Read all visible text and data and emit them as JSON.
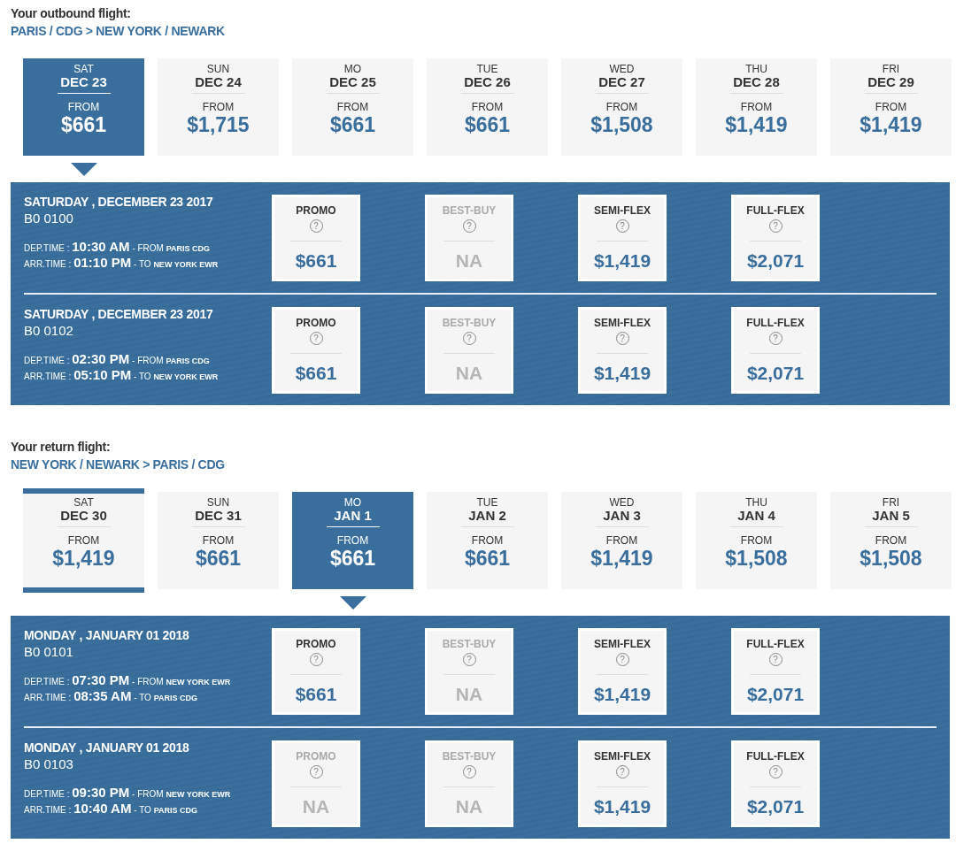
{
  "sections": [
    {
      "title": "Your outbound flight:",
      "route": "PARIS / CDG > NEW YORK / NEWARK",
      "days": [
        {
          "weekday": "SAT",
          "date": "DEC 23",
          "from": "FROM",
          "price": "$661",
          "selected": true,
          "bordered": false
        },
        {
          "weekday": "SUN",
          "date": "DEC 24",
          "from": "FROM",
          "price": "$1,715",
          "selected": false,
          "bordered": false
        },
        {
          "weekday": "MO",
          "date": "DEC 25",
          "from": "FROM",
          "price": "$661",
          "selected": false,
          "bordered": false
        },
        {
          "weekday": "TUE",
          "date": "DEC 26",
          "from": "FROM",
          "price": "$661",
          "selected": false,
          "bordered": false
        },
        {
          "weekday": "WED",
          "date": "DEC 27",
          "from": "FROM",
          "price": "$1,508",
          "selected": false,
          "bordered": false
        },
        {
          "weekday": "THU",
          "date": "DEC 28",
          "from": "FROM",
          "price": "$1,419",
          "selected": false,
          "bordered": false
        },
        {
          "weekday": "FRI",
          "date": "DEC 29",
          "from": "FROM",
          "price": "$1,419",
          "selected": false,
          "bordered": false
        }
      ],
      "flights": [
        {
          "date": "SATURDAY , DECEMBER 23 2017",
          "number": "B0 0100",
          "dep_label": "DEP.TIME :",
          "dep_time": "10:30 AM",
          "dep_prefix": "- FROM",
          "dep_place": "PARIS CDG",
          "arr_label": "ARR.TIME :",
          "arr_time": "01:10 PM",
          "arr_prefix": "- TO",
          "arr_place": "NEW YORK EWR",
          "fares": [
            {
              "name": "PROMO",
              "help": "?",
              "price": "$661",
              "available": true
            },
            {
              "name": "BEST-BUY",
              "help": "?",
              "price": "NA",
              "available": false
            },
            {
              "name": "SEMI-FLEX",
              "help": "?",
              "price": "$1,419",
              "available": true
            },
            {
              "name": "FULL-FLEX",
              "help": "?",
              "price": "$2,071",
              "available": true
            }
          ]
        },
        {
          "date": "SATURDAY , DECEMBER 23 2017",
          "number": "B0 0102",
          "dep_label": "DEP.TIME :",
          "dep_time": "02:30 PM",
          "dep_prefix": "- FROM",
          "dep_place": "PARIS CDG",
          "arr_label": "ARR.TIME :",
          "arr_time": "05:10 PM",
          "arr_prefix": "- TO",
          "arr_place": "NEW YORK EWR",
          "fares": [
            {
              "name": "PROMO",
              "help": "?",
              "price": "$661",
              "available": true
            },
            {
              "name": "BEST-BUY",
              "help": "?",
              "price": "NA",
              "available": false
            },
            {
              "name": "SEMI-FLEX",
              "help": "?",
              "price": "$1,419",
              "available": true
            },
            {
              "name": "FULL-FLEX",
              "help": "?",
              "price": "$2,071",
              "available": true
            }
          ]
        }
      ]
    },
    {
      "title": "Your return flight:",
      "route": "NEW YORK / NEWARK > PARIS / CDG",
      "days": [
        {
          "weekday": "SAT",
          "date": "DEC 30",
          "from": "FROM",
          "price": "$1,419",
          "selected": false,
          "bordered": true
        },
        {
          "weekday": "SUN",
          "date": "DEC 31",
          "from": "FROM",
          "price": "$661",
          "selected": false,
          "bordered": false
        },
        {
          "weekday": "MO",
          "date": "JAN 1",
          "from": "FROM",
          "price": "$661",
          "selected": true,
          "bordered": false
        },
        {
          "weekday": "TUE",
          "date": "JAN 2",
          "from": "FROM",
          "price": "$661",
          "selected": false,
          "bordered": false
        },
        {
          "weekday": "WED",
          "date": "JAN 3",
          "from": "FROM",
          "price": "$1,419",
          "selected": false,
          "bordered": false
        },
        {
          "weekday": "THU",
          "date": "JAN 4",
          "from": "FROM",
          "price": "$1,508",
          "selected": false,
          "bordered": false
        },
        {
          "weekday": "FRI",
          "date": "JAN 5",
          "from": "FROM",
          "price": "$1,508",
          "selected": false,
          "bordered": false
        }
      ],
      "flights": [
        {
          "date": "MONDAY , JANUARY 01 2018",
          "number": "B0 0101",
          "dep_label": "DEP.TIME :",
          "dep_time": "07:30 PM",
          "dep_prefix": "- FROM",
          "dep_place": "NEW YORK EWR",
          "arr_label": "ARR.TIME :",
          "arr_time": "08:35 AM",
          "arr_prefix": "- TO",
          "arr_place": "PARIS CDG",
          "fares": [
            {
              "name": "PROMO",
              "help": "?",
              "price": "$661",
              "available": true
            },
            {
              "name": "BEST-BUY",
              "help": "?",
              "price": "NA",
              "available": false
            },
            {
              "name": "SEMI-FLEX",
              "help": "?",
              "price": "$1,419",
              "available": true
            },
            {
              "name": "FULL-FLEX",
              "help": "?",
              "price": "$2,071",
              "available": true
            }
          ]
        },
        {
          "date": "MONDAY , JANUARY 01 2018",
          "number": "B0 0103",
          "dep_label": "DEP.TIME :",
          "dep_time": "09:30 PM",
          "dep_prefix": "- FROM",
          "dep_place": "NEW YORK EWR",
          "arr_label": "ARR.TIME :",
          "arr_time": "10:40 AM",
          "arr_prefix": "- TO",
          "arr_place": "PARIS CDG",
          "fares": [
            {
              "name": "PROMO",
              "help": "?",
              "price": "NA",
              "available": false
            },
            {
              "name": "BEST-BUY",
              "help": "?",
              "price": "NA",
              "available": false
            },
            {
              "name": "SEMI-FLEX",
              "help": "?",
              "price": "$1,419",
              "available": true
            },
            {
              "name": "FULL-FLEX",
              "help": "?",
              "price": "$2,071",
              "available": true
            }
          ]
        }
      ]
    }
  ]
}
